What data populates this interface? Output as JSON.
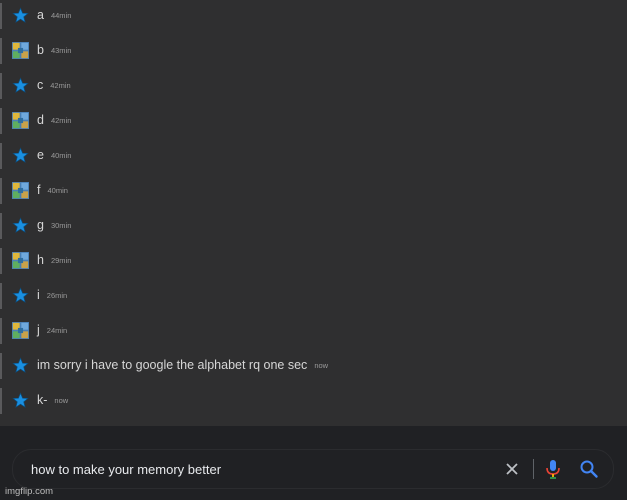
{
  "messages": [
    {
      "text": "a",
      "time": "44min",
      "icon": "star-icon"
    },
    {
      "text": "b",
      "time": "43min",
      "icon": "image-avatar-icon"
    },
    {
      "text": "c",
      "time": "42min",
      "icon": "star-icon"
    },
    {
      "text": "d",
      "time": "42min",
      "icon": "image-avatar-icon"
    },
    {
      "text": "e",
      "time": "40min",
      "icon": "star-icon"
    },
    {
      "text": "f",
      "time": "40min",
      "icon": "image-avatar-icon"
    },
    {
      "text": "g",
      "time": "30min",
      "icon": "star-icon"
    },
    {
      "text": "h",
      "time": "29min",
      "icon": "image-avatar-icon"
    },
    {
      "text": "i",
      "time": "26min",
      "icon": "star-icon"
    },
    {
      "text": "j",
      "time": "24min",
      "icon": "image-avatar-icon"
    },
    {
      "text": "im sorry i have to google the alphabet rq one sec",
      "time": "now",
      "icon": "star-icon"
    },
    {
      "text": "k-",
      "time": "now",
      "icon": "star-icon"
    }
  ],
  "search": {
    "query": "how to make your memory better"
  },
  "watermark": "imgflip.com",
  "colors": {
    "star": "#1a8fe0",
    "mic_blue": "#4285f4",
    "mic_red": "#ea4335",
    "mic_yellow": "#fbbc04",
    "mic_green": "#34a853"
  }
}
